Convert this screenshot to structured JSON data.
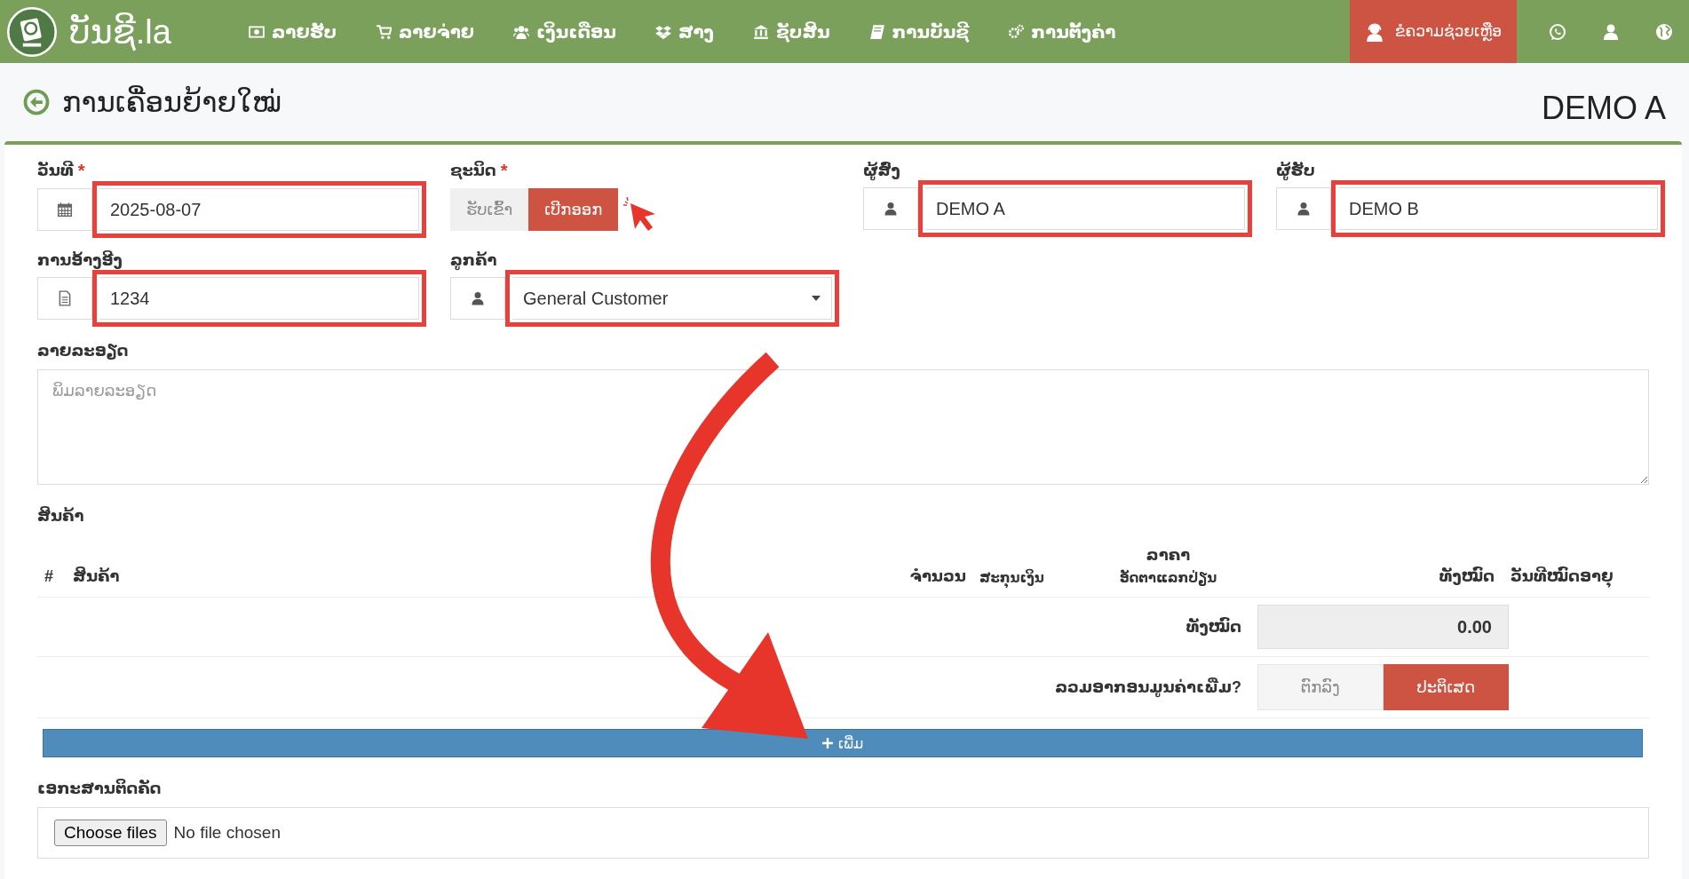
{
  "nav": {
    "logo": "ບັນຊີ.la",
    "items": [
      {
        "label": "ລາຍຮັບ",
        "kind": "money"
      },
      {
        "label": "ລາຍຈ່າຍ",
        "kind": "cart"
      },
      {
        "label": "ເງິນເດືອນ",
        "kind": "users"
      },
      {
        "label": "ສາງ",
        "kind": "boxes"
      },
      {
        "label": "ຊັບສິນ",
        "kind": "bank"
      },
      {
        "label": "ການບັນຊີ",
        "kind": "book"
      },
      {
        "label": "ການຕັ້ງຄ່າ",
        "kind": "gears"
      }
    ],
    "help": "ຂໍຄວາມຊ່ວຍເຫຼືອ"
  },
  "page": {
    "title": "ການເຄື່ອນຍ້າຍໃໝ່",
    "company": "DEMO A"
  },
  "fields": [
    {
      "kind": "date",
      "label": "ວັນທີ",
      "required_mark": "*",
      "value": "2025-08-07",
      "highlighted": true
    },
    {
      "kind": "toggle",
      "label": "ຊະນິດ",
      "required_mark": "*",
      "options": [
        {
          "label": "ຮັບເຂົ້າ",
          "selected": false
        },
        {
          "label": "ເບີກອອກ",
          "selected": true
        }
      ]
    },
    {
      "kind": "person",
      "label": "ຜູ້ສົ່ງ",
      "value": "DEMO A",
      "highlighted": true
    },
    {
      "kind": "person",
      "label": "ຜູ້ຮັບ",
      "value": "DEMO B",
      "highlighted": true
    },
    {
      "kind": "reference",
      "label": "ການອ້າງອີງ",
      "value": "1234",
      "highlighted": true
    },
    {
      "kind": "select",
      "label": "ລູກຄ້າ",
      "value": "General Customer",
      "highlighted": true
    }
  ],
  "description": {
    "label": "ລາຍລະອຽດ",
    "placeholder": "ພິມລາຍລະອຽດ"
  },
  "products": {
    "label": "ສິນຄ້າ",
    "columns": [
      {
        "label": "#"
      },
      {
        "label": "ສິນຄ້າ"
      },
      {
        "label": "ຈຳນວນ"
      },
      {
        "label": "ສະກຸນເງິນ"
      },
      {
        "label": "ລາຄາ",
        "sublabel": "ອັດຕາແລກປ່ຽນ"
      },
      {
        "label": "ທັງໝົດ"
      },
      {
        "label": "ວັນທີໝົດອາຍຸ"
      }
    ],
    "total_label": "ທັງໝົດ",
    "total_value": "0.00",
    "vat_label": "ລວມອາກອນມູນຄ່າເພີ່ມ?",
    "vat_options": [
      {
        "label": "ຕົກລົງ",
        "selected": false
      },
      {
        "label": "ປະຕິເສດ",
        "selected": true
      }
    ],
    "add_button": "ເພີ່ມ"
  },
  "attachments": {
    "label": "ເອກະສານຕິດຄັດ",
    "button": "Choose files",
    "status": "No file chosen"
  }
}
